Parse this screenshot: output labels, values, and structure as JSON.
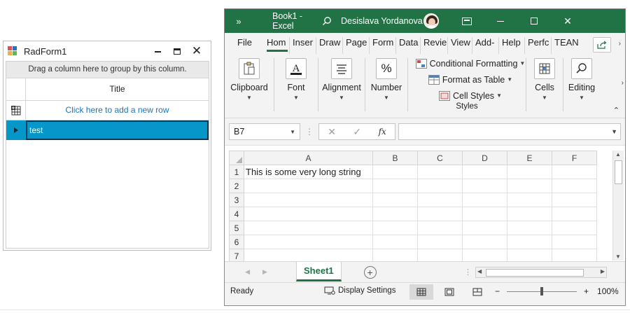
{
  "radform": {
    "title": "RadForm1",
    "group_panel_text": "Drag a column here to group by this column.",
    "column_header": "Title",
    "new_row_text": "Click here to add a new row",
    "rows": [
      {
        "title": "test"
      }
    ],
    "colors": {
      "selected_row": "#0597c7",
      "new_row_text": "#1a75b8"
    }
  },
  "excel": {
    "titlebar": {
      "document": "Book1  -  Excel",
      "user": "Desislava Yordanova",
      "accent": "#217346"
    },
    "ribbon_tabs": [
      "File",
      "Hom",
      "Inser",
      "Draw",
      "Page",
      "Form",
      "Data",
      "Revie",
      "View",
      "Add-",
      "Help",
      "Perfc",
      "TEAN"
    ],
    "active_tab": "Hom",
    "ribbon": {
      "clipboard": "Clipboard",
      "font": "Font",
      "alignment": "Alignment",
      "number": "Number",
      "number_icon": "%",
      "conditional_formatting": "Conditional Formatting",
      "format_as_table": "Format as Table",
      "cell_styles": "Cell Styles",
      "styles_group": "Styles",
      "cells": "Cells",
      "editing": "Editing"
    },
    "formula_bar": {
      "name_box": "B7",
      "fx": "fx",
      "value": ""
    },
    "columns": [
      "A",
      "B",
      "C",
      "D",
      "E",
      "F"
    ],
    "rows": [
      "1",
      "2",
      "3",
      "4",
      "5",
      "6",
      "7"
    ],
    "cells": {
      "A1": "This is some very long string"
    },
    "sheet_tab": "Sheet1",
    "status": {
      "ready": "Ready",
      "display_settings": "Display Settings",
      "zoom_minus": "−",
      "zoom_plus": "+",
      "zoom": "100%"
    }
  }
}
